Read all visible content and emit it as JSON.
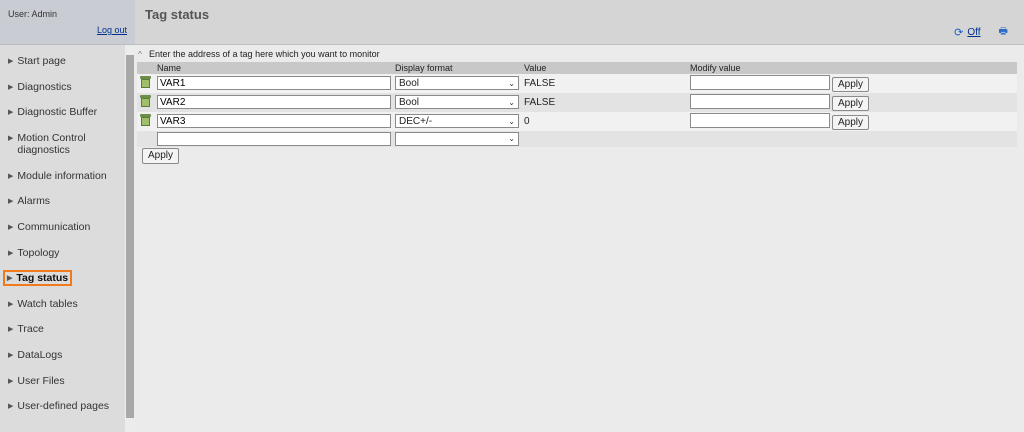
{
  "user": {
    "label": "User: Admin",
    "logout": "Log out"
  },
  "header": {
    "title": "Tag status",
    "refresh_icon": "refresh-icon",
    "off_label": "Off",
    "print_icon": "print-icon"
  },
  "nav": {
    "items": [
      {
        "label": "Start page"
      },
      {
        "label": "Diagnostics"
      },
      {
        "label": "Diagnostic Buffer"
      },
      {
        "label": "Motion Control diagnostics"
      },
      {
        "label": "Module information"
      },
      {
        "label": "Alarms"
      },
      {
        "label": "Communication"
      },
      {
        "label": "Topology"
      },
      {
        "label": "Tag status",
        "active": true
      },
      {
        "label": "Watch tables"
      },
      {
        "label": "Trace"
      },
      {
        "label": "DataLogs"
      },
      {
        "label": "User Files"
      },
      {
        "label": "User-defined pages"
      }
    ]
  },
  "content": {
    "hint": "Enter the address of a tag here which you want to monitor",
    "columns": {
      "name": "Name",
      "format": "Display format",
      "value": "Value",
      "modify": "Modify value"
    },
    "rows": [
      {
        "name": "VAR1",
        "format": "Bool",
        "value": "FALSE",
        "modify": "",
        "apply": "Apply"
      },
      {
        "name": "VAR2",
        "format": "Bool",
        "value": "FALSE",
        "modify": "",
        "apply": "Apply"
      },
      {
        "name": "VAR3",
        "format": "DEC+/-",
        "value": "0",
        "modify": "",
        "apply": "Apply"
      },
      {
        "name": "",
        "format": "",
        "value": ""
      }
    ],
    "apply_label": "Apply"
  },
  "colors": {
    "active_border": "#f07a1c",
    "link": "#00308f"
  }
}
